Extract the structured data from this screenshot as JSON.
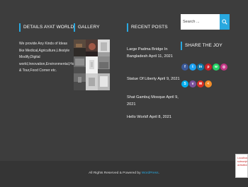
{
  "colors": {
    "accent": "#29a8df",
    "background": "#3d3d3d",
    "bottom_bar": "#353535"
  },
  "about": {
    "title": "DETAILS AYAT WORLD",
    "text": "We provide Any Kinds of Ideas like Medical,Agriculture,Lifestyle Modify,Digital world,Innovation,Environmental,Hotel & Tour,Food Corner etc."
  },
  "gallery": {
    "title": "GALLERY"
  },
  "recent_posts": {
    "title": "RECENT POSTS",
    "items": [
      {
        "label": "Large Padma Bridge In Bangladesh April 11, 2021"
      },
      {
        "label": "Statue Of Liberty April 9, 2021"
      },
      {
        "label": "Shat Gambuj Mosque April 9, 2021"
      },
      {
        "label": "Hello World! April 8, 2021"
      }
    ]
  },
  "search": {
    "placeholder": "Search ..."
  },
  "share": {
    "title": "SHARE THE JOY",
    "icons": [
      "facebook-icon",
      "twitter-icon",
      "linkedin-icon",
      "pinterest-icon",
      "whatsapp-icon",
      "instagram-icon",
      "skype-icon",
      "viber-icon",
      "mail-icon",
      "share-icon"
    ]
  },
  "footer": {
    "prefix": "All Rights Reserved & Powered by ",
    "link": "WordPress",
    "suffix": "."
  },
  "badge": {
    "text": "Localhost subscription activation"
  }
}
